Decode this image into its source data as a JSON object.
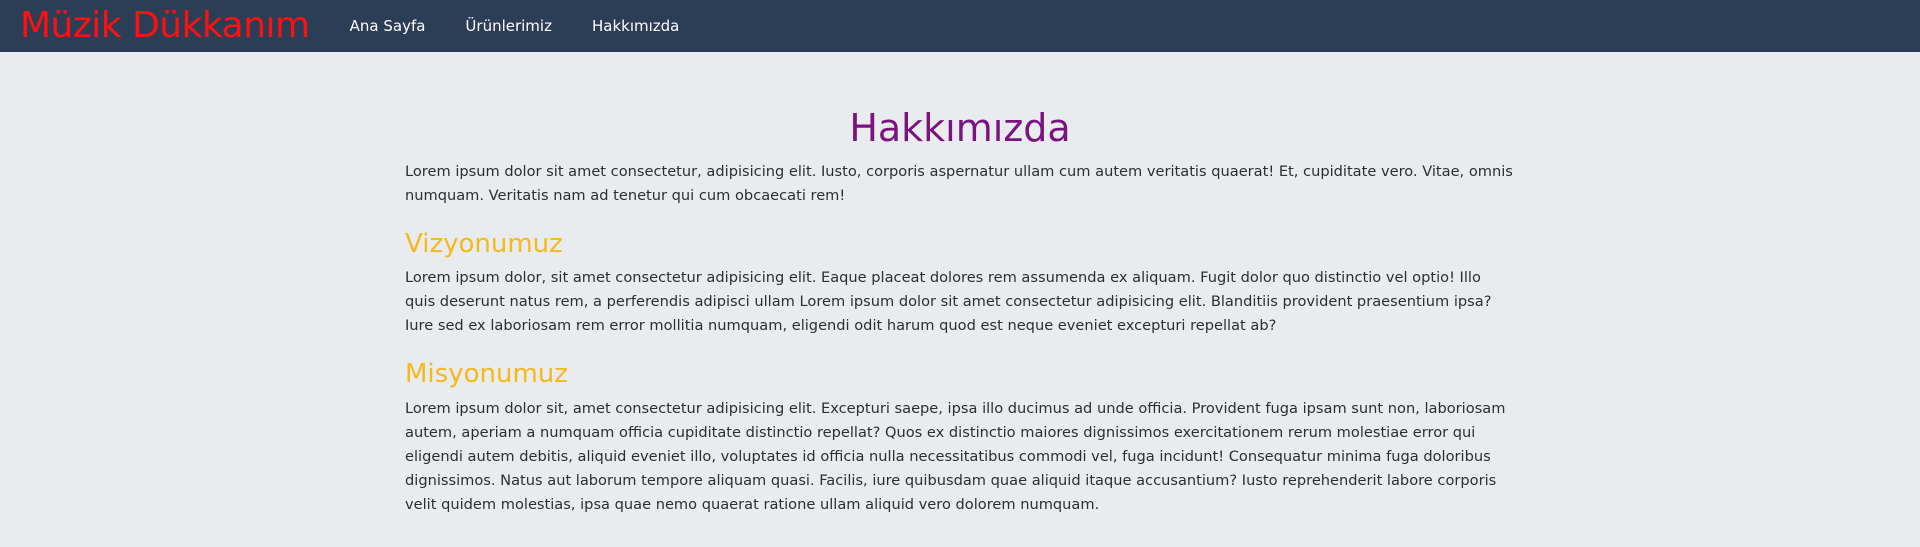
{
  "navbar": {
    "brand": "Müzik Dükkanım",
    "links": [
      "Ana Sayfa",
      "Ürünlerimiz",
      "Hakkımızda"
    ]
  },
  "main": {
    "title": "Hakkımızda",
    "intro": "Lorem ipsum dolor sit amet consectetur, adipisicing elit. Iusto, corporis aspernatur ullam cum autem veritatis quaerat! Et, cupiditate vero. Vitae, omnis numquam. Veritatis nam ad tenetur qui cum obcaecati rem!",
    "sections": [
      {
        "title": "Vizyonumuz",
        "text": "Lorem ipsum dolor, sit amet consectetur adipisicing elit. Eaque placeat dolores rem assumenda ex aliquam. Fugit dolor quo distinctio vel optio! Illo quis deserunt natus rem, a perferendis adipisci ullam Lorem ipsum dolor sit amet consectetur adipisicing elit. Blanditiis provident praesentium ipsa? Iure sed ex laboriosam rem error mollitia numquam, eligendi odit harum quod est neque eveniet excepturi repellat ab?"
      },
      {
        "title": "Misyonumuz",
        "text": "Lorem ipsum dolor sit, amet consectetur adipisicing elit. Excepturi saepe, ipsa illo ducimus ad unde officia. Provident fuga ipsam sunt non, laboriosam autem, aperiam a numquam officia cupiditate distinctio repellat? Quos ex distinctio maiores dignissimos exercitationem rerum molestiae error qui eligendi autem debitis, aliquid eveniet illo, voluptates id officia nulla necessitatibus commodi vel, fuga incidunt! Consequatur minima fuga doloribus dignissimos. Natus aut laborum tempore aliquam quasi. Facilis, iure quibusdam quae aliquid itaque accusantium? Iusto reprehenderit labore corporis velit quidem molestias, ipsa quae nemo quaerat ratione ullam aliquid vero dolorem numquam."
      }
    ]
  },
  "colors": {
    "navbar_bg": "#2c3e56",
    "brand": "#ff1010",
    "page_bg": "#e8ecef",
    "title": "#7b127f",
    "section_title": "#f6b81b"
  }
}
